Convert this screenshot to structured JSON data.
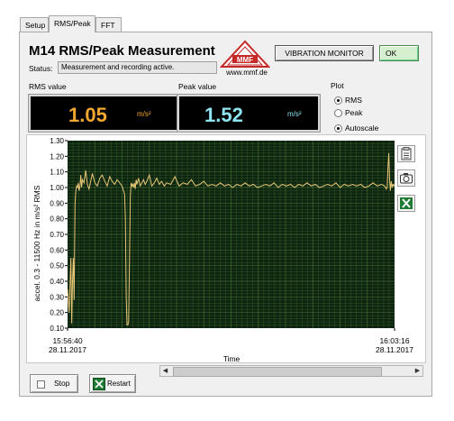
{
  "tabs": [
    {
      "label": "Setup"
    },
    {
      "label": "RMS/Peak",
      "active": true
    },
    {
      "label": "FFT"
    }
  ],
  "header": {
    "title": "M14 RMS/Peak Measurement",
    "status_label": "Status:",
    "status_value": "Measurement and recording active.",
    "logo_text": "MMF",
    "logo_url": "www.mmf.de",
    "vibration_button": "VIBRATION MONITOR",
    "ok_button": "OK"
  },
  "rms": {
    "label": "RMS value",
    "value": "1.05",
    "unit": "m/s²",
    "color": "#f5a830"
  },
  "peak": {
    "label": "Peak value",
    "value": "1.52",
    "unit": "m/s²",
    "color": "#8ee4f0"
  },
  "plot_options": {
    "label": "Plot",
    "rms_option": "RMS",
    "peak_option": "Peak",
    "autoscale_option": "Autoscale",
    "selected": "RMS",
    "autoscale": true
  },
  "chart_data": {
    "type": "line",
    "ylabel": "accel. 0.3 - 11500 Hz in m/s² RMS",
    "xlabel": "Time",
    "ylim": [
      0.1,
      1.3
    ],
    "yticks": [
      "0.10",
      "0.20",
      "0.30",
      "0.40",
      "0.50",
      "0.60",
      "0.70",
      "0.80",
      "0.90",
      "1.00",
      "1.10",
      "1.20",
      "1.30"
    ],
    "x_start": {
      "time": "15:56:40",
      "date": "28.11.2017"
    },
    "x_end": {
      "time": "16:03:16",
      "date": "28.11.2017"
    },
    "grid": true,
    "background": "#0d2410",
    "grid_color": "#3f6b2f",
    "series": [
      {
        "color": "#e8c777",
        "x_seconds": [
          0,
          2,
          4,
          5,
          6,
          7,
          8,
          9,
          10,
          11,
          12,
          13,
          14,
          15,
          16,
          17,
          18,
          20,
          22,
          24,
          26,
          28,
          30,
          33,
          36,
          39,
          42,
          45,
          48,
          51,
          54,
          57,
          60,
          63,
          66,
          69,
          70,
          71,
          72,
          73,
          74,
          75,
          76,
          77,
          78,
          79,
          80,
          81,
          82,
          83,
          84,
          86,
          88,
          90,
          92,
          94,
          96,
          99,
          102,
          105,
          108,
          111,
          114,
          117,
          120,
          125,
          130,
          135,
          140,
          145,
          150,
          155,
          160,
          165,
          170,
          175,
          180,
          185,
          190,
          195,
          200,
          205,
          210,
          215,
          220,
          225,
          230,
          235,
          240,
          245,
          250,
          255,
          260,
          265,
          270,
          275,
          280,
          285,
          290,
          295,
          300,
          305,
          310,
          315,
          320,
          325,
          330,
          335,
          340,
          345,
          350,
          355,
          360,
          365,
          370,
          375,
          380,
          384,
          386,
          387,
          388,
          389,
          390,
          391,
          392,
          393,
          394,
          395,
          396
        ],
        "values": [
          0.35,
          0.2,
          0.55,
          0.13,
          0.4,
          0.55,
          0.28,
          0.9,
          0.98,
          1.01,
          1.0,
          1.03,
          0.98,
          1.01,
          1.08,
          1.0,
          1.05,
          1.03,
          1.11,
          1.02,
          0.99,
          1.04,
          1.09,
          1.03,
          1.01,
          1.06,
          1.08,
          1.04,
          1.01,
          1.07,
          1.04,
          1.02,
          1.05,
          1.03,
          1.01,
          0.96,
          0.8,
          0.3,
          0.12,
          0.12,
          0.14,
          0.55,
          0.95,
          1.03,
          1.01,
          1.02,
          1.0,
          1.03,
          0.99,
          1.05,
          1.02,
          1.06,
          1.01,
          1.03,
          1.05,
          1.02,
          1.04,
          1.08,
          1.01,
          1.03,
          1.06,
          1.02,
          1.04,
          1.01,
          1.03,
          1.02,
          1.07,
          1.01,
          1.03,
          1.02,
          1.05,
          1.01,
          1.02,
          1.04,
          1.01,
          1.02,
          1.01,
          1.03,
          1.01,
          1.02,
          1.0,
          1.02,
          1.01,
          1.03,
          1.01,
          1.02,
          1.0,
          1.01,
          1.02,
          1.01,
          1.03,
          1.0,
          1.02,
          1.01,
          1.02,
          1.0,
          1.02,
          1.01,
          1.03,
          1.01,
          1.02,
          1.0,
          1.01,
          1.02,
          1.01,
          1.03,
          1.0,
          1.02,
          1.01,
          1.02,
          1.01,
          1.02,
          1.0,
          1.01,
          1.03,
          1.01,
          1.02,
          1.01,
          0.99,
          1.0,
          1.13,
          1.22,
          1.05,
          0.98,
          1.04,
          1.0,
          1.02,
          1.01,
          1.02
        ]
      }
    ]
  },
  "footer": {
    "stop_button": "Stop",
    "restart_button": "Restart"
  }
}
